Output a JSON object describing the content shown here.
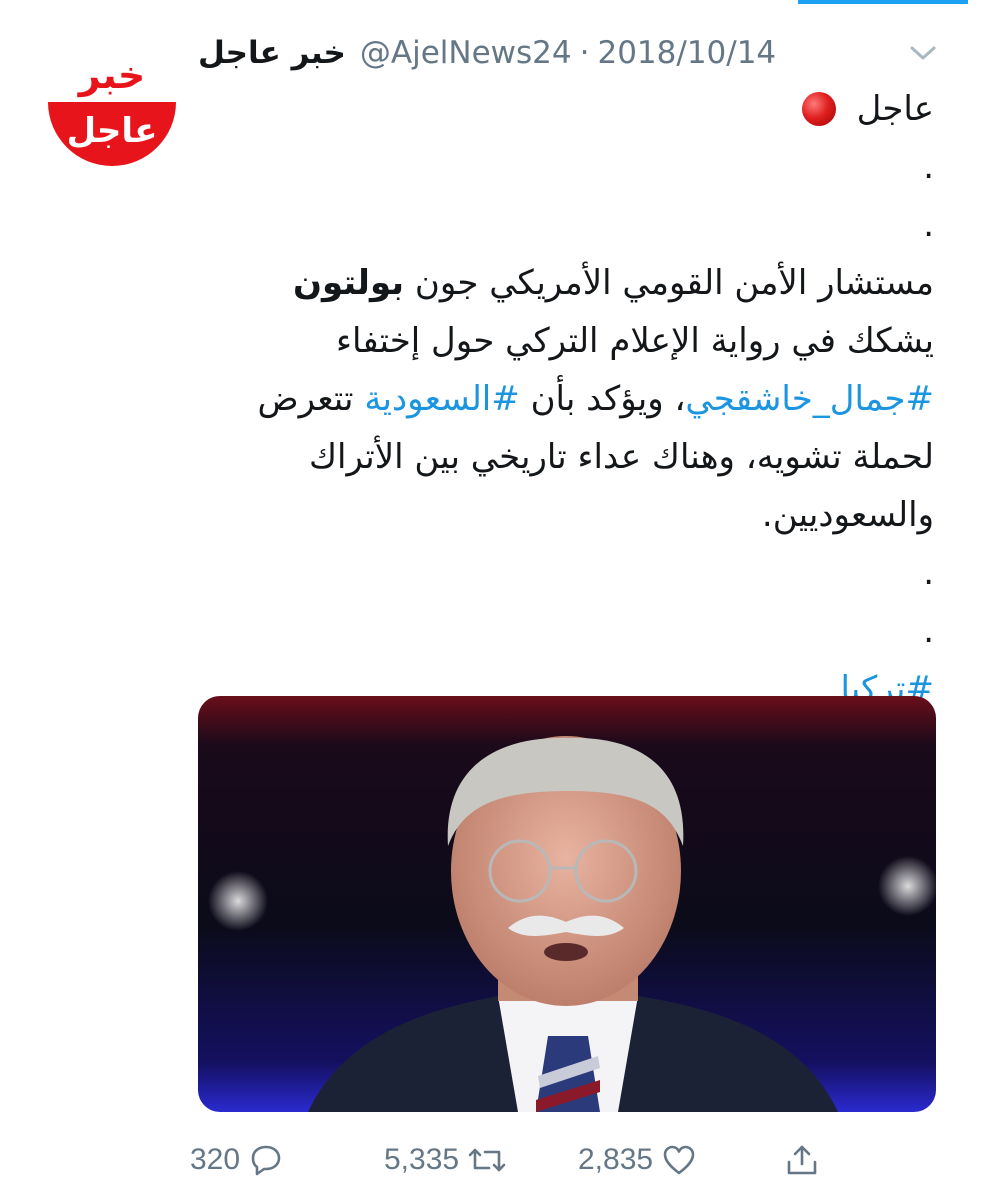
{
  "tweet": {
    "display_name": "خبر عاجل",
    "handle": "@AjelNews24",
    "separator": "·",
    "date": "2018/10/14",
    "avatar": {
      "top_text": "خبر",
      "bottom_text": "عاجل",
      "colors": {
        "red": "#e8141b",
        "white": "#ffffff"
      }
    },
    "lines": {
      "l1": "عاجل",
      "dot1": ".",
      "dot2": ".",
      "l2a": "مستشار الأمن القومي الأمريكي جون",
      "l2b": "بولتون",
      "l3": "يشكك في رواية الإعلام التركي حول إختفاء",
      "l4_hashtag1": "#جمال_خاشقجي",
      "l4_mid": "، ويؤكد بأن",
      "l4_hashtag2": "#السعودية",
      "l4_end": "تتعرض",
      "l5": "لحملة تشويه، وهناك عداء تاريخي بين الأتراك",
      "l6": "والسعوديين.",
      "dot3": ".",
      "dot4": ".",
      "hashtag3": "#تركيا",
      "dot5": "."
    },
    "actions": {
      "replies": "320",
      "retweets": "5,335",
      "likes": "2,835"
    },
    "colors": {
      "hashtag": "#1b95e0",
      "secondary": "#657786",
      "accent": "#1da1f2"
    }
  }
}
